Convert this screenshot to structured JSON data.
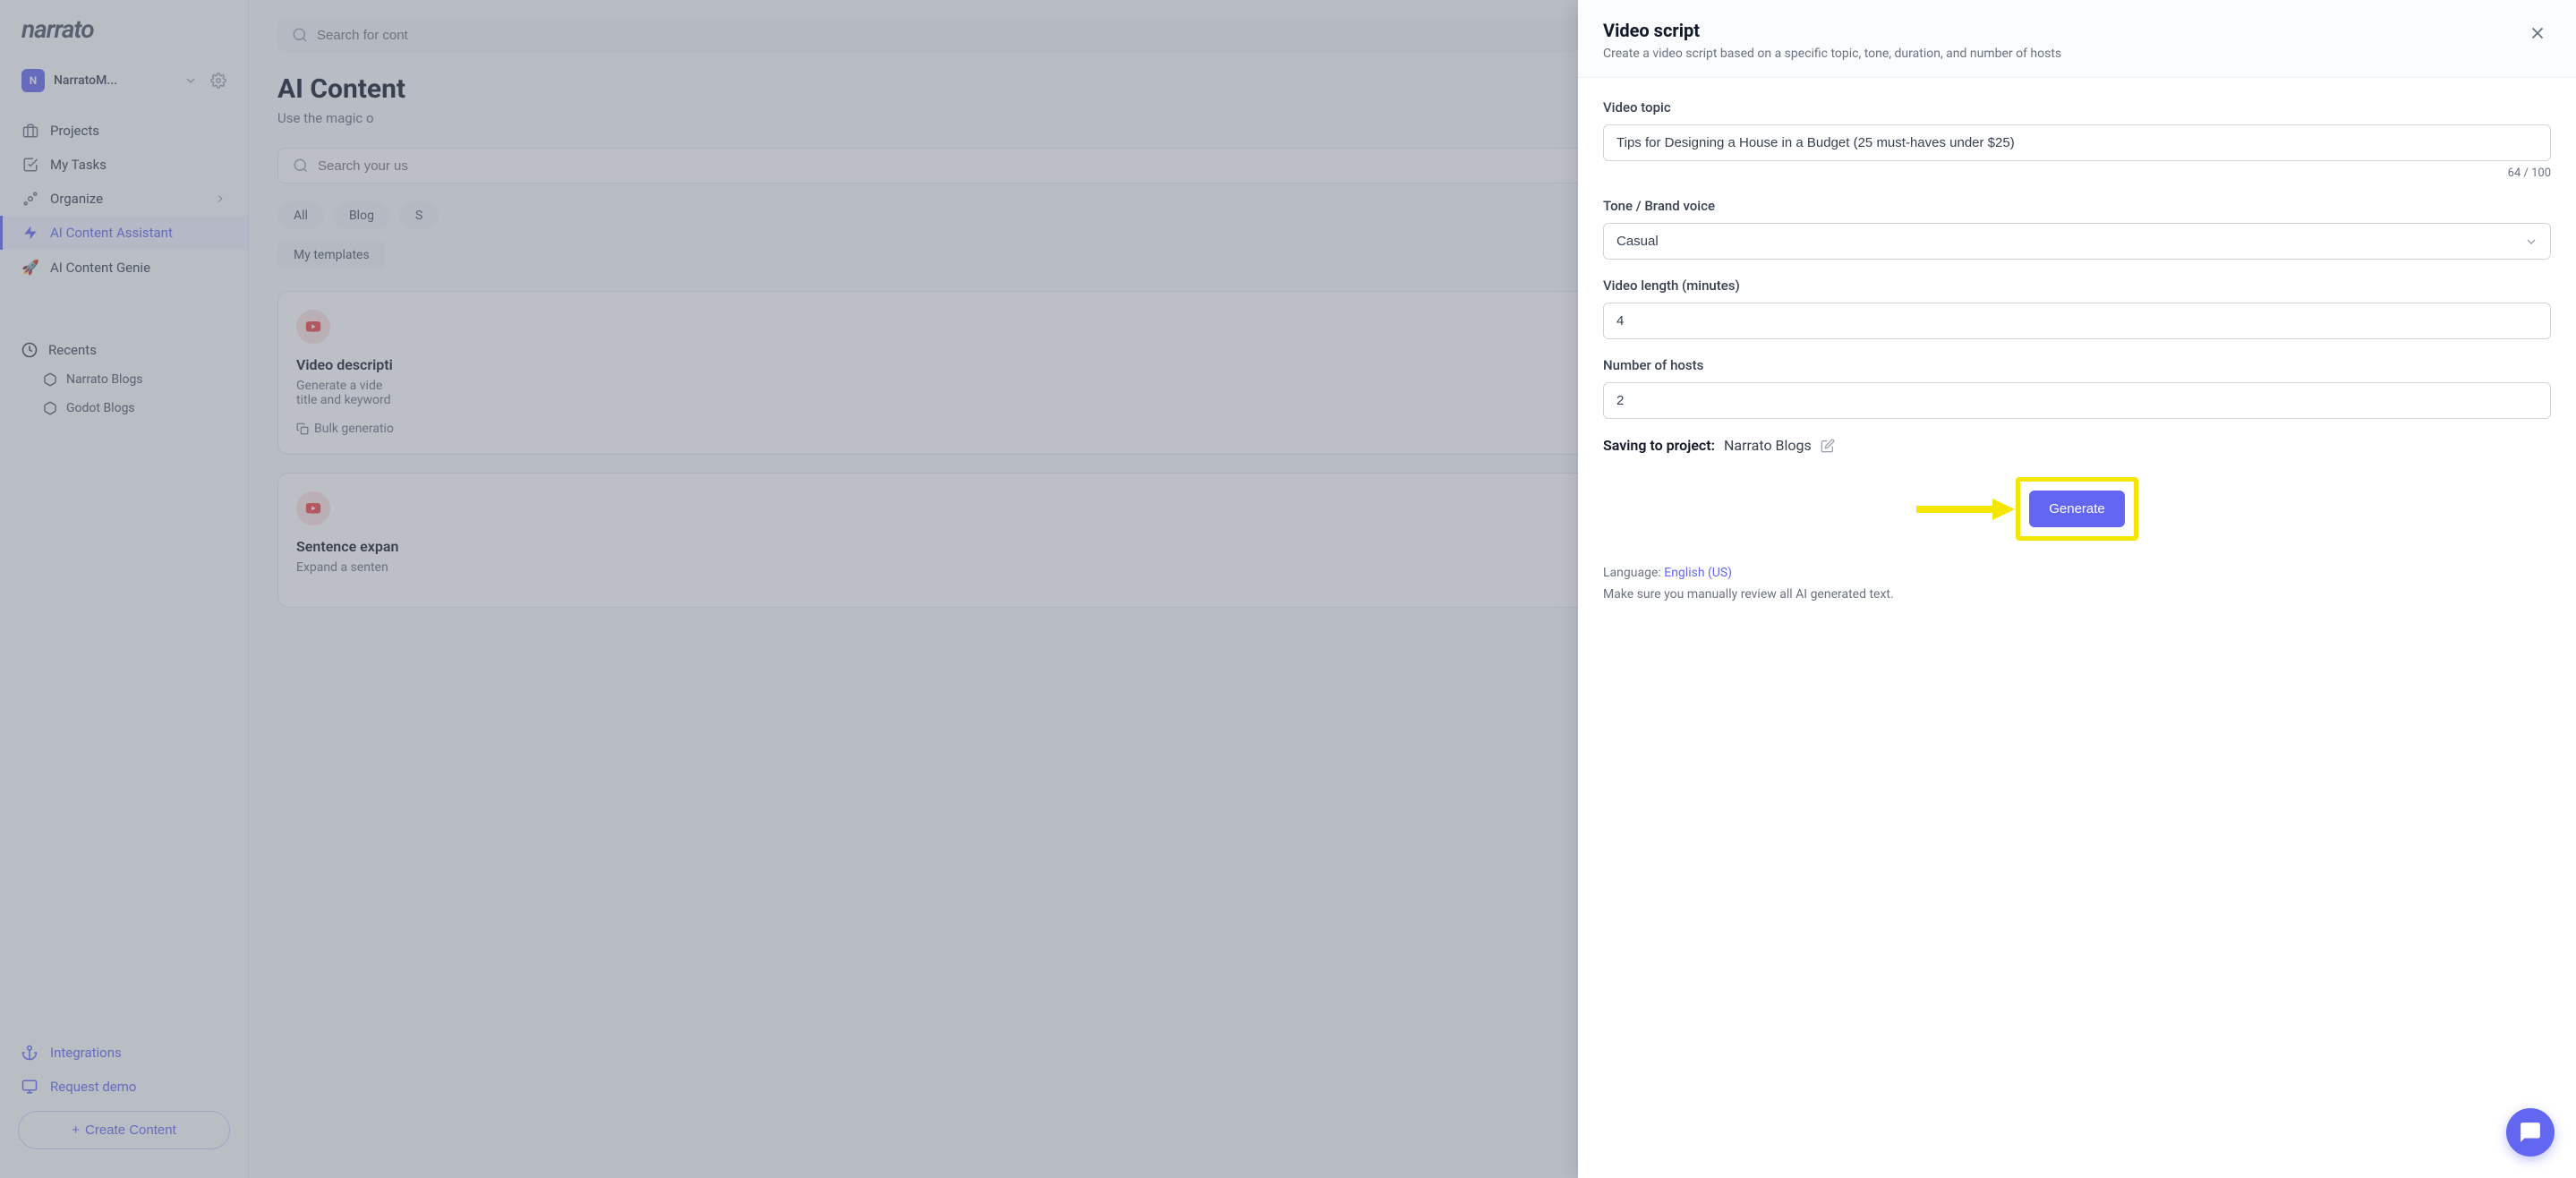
{
  "logo": "narrato",
  "workspace": {
    "avatar_letter": "N",
    "name": "NarratoM..."
  },
  "sidebar_nav": {
    "projects": "Projects",
    "my_tasks": "My Tasks",
    "organize": "Organize",
    "ai_assistant": "AI Content Assistant",
    "ai_genie": "AI Content Genie"
  },
  "recents": {
    "header": "Recents",
    "items": [
      "Narrato Blogs",
      "Godot Blogs"
    ]
  },
  "sidebar_footer": {
    "integrations": "Integrations",
    "request_demo": "Request demo",
    "create_content": "Create Content"
  },
  "main": {
    "search_placeholder": "Search for cont",
    "page_title": "AI Content",
    "page_subtitle": "Use the magic o",
    "usecase_placeholder": "Search your us",
    "filters": [
      "All",
      "Blog",
      "S"
    ],
    "my_templates": "My templates",
    "cards": [
      {
        "title": "Video descripti",
        "desc": "Generate a vide",
        "desc2": "title and keyword",
        "action": "Bulk generatio"
      },
      {
        "title": "Sentence expan",
        "desc": "Expand a senten"
      }
    ]
  },
  "modal": {
    "title": "Video script",
    "subtitle": "Create a video script based on a specific topic, tone, duration, and number of hosts",
    "fields": {
      "topic_label": "Video topic",
      "topic_value": "Tips for Designing a House in a Budget (25 must-haves under $25)",
      "topic_count": "64 / 100",
      "tone_label": "Tone / Brand voice",
      "tone_value": "Casual",
      "length_label": "Video length (minutes)",
      "length_value": "4",
      "hosts_label": "Number of hosts",
      "hosts_value": "2"
    },
    "saving_label": "Saving to project:",
    "saving_value": "Narrato Blogs",
    "generate_btn": "Generate",
    "language_label": "Language: ",
    "language_value": "English (US)",
    "review_note": "Make sure you manually review all AI generated text."
  }
}
